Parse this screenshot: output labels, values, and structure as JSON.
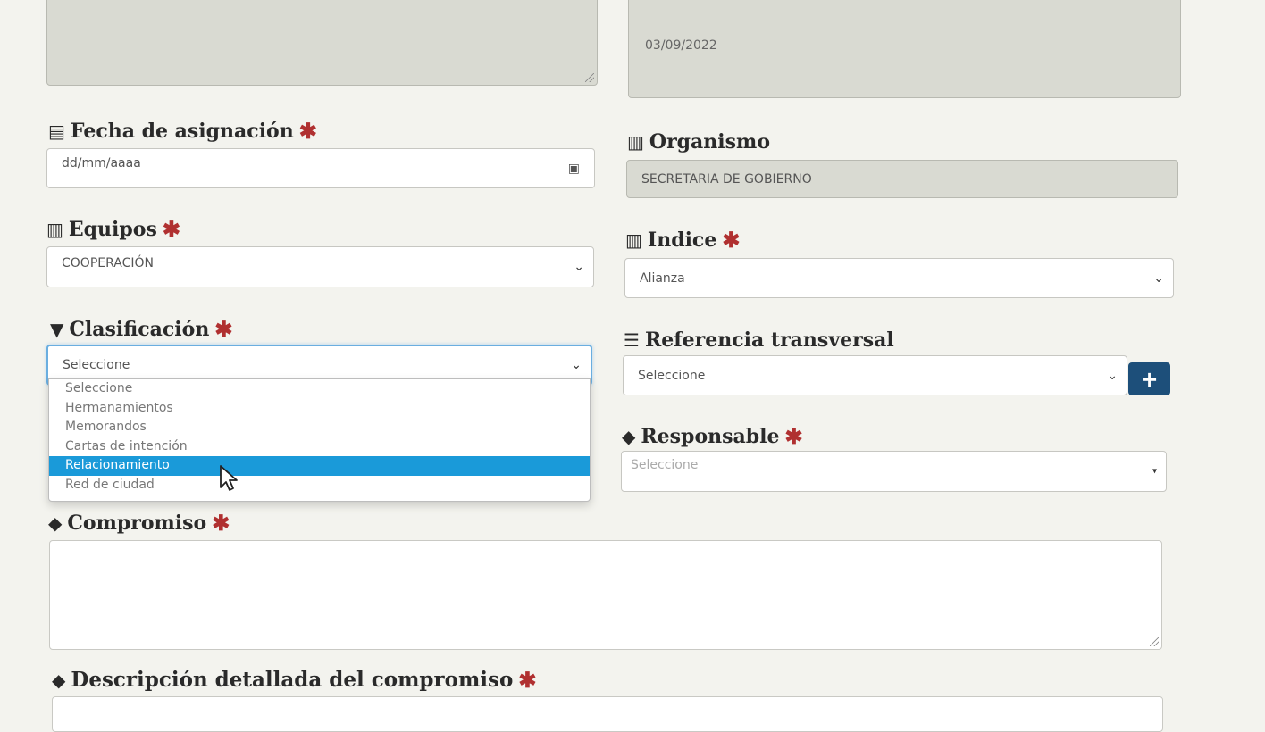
{
  "top": {
    "left_textarea_value": "",
    "right_date_value": "03/09/2022"
  },
  "fields": {
    "fecha_asignacion": {
      "label": "Fecha de asignación",
      "placeholder": "dd/mm/aaaa",
      "icon": "calendar-icon"
    },
    "organismo": {
      "label": "Organismo",
      "value": "SECRETARIA DE GOBIERNO",
      "icon": "barcode-icon"
    },
    "equipos": {
      "label": "Equipos",
      "value": "COOPERACIÓN",
      "icon": "barcode-icon"
    },
    "indice": {
      "label": "Indice",
      "value": "Alianza",
      "icon": "barcode-icon"
    },
    "clasificacion": {
      "label": "Clasificación",
      "value": "Seleccione",
      "icon": "filter-icon",
      "options": [
        "Seleccione",
        "Hermanamientos",
        "Memorandos",
        "Cartas de intención",
        "Relacionamiento",
        "Red de ciudad"
      ],
      "highlighted": "Relacionamiento"
    },
    "referencia_transversal": {
      "label": "Referencia transversal",
      "value": "Seleccione",
      "icon": "list-icon",
      "add_label": "+"
    },
    "responsable": {
      "label": "Responsable",
      "value": "Seleccione",
      "icon": "tag-icon"
    },
    "compromiso": {
      "label": "Compromiso",
      "icon": "tag-icon"
    },
    "descripcion": {
      "label": "Descripción detallada del compromiso",
      "icon": "tag-icon"
    }
  },
  "required_mark": "✱",
  "colors": {
    "required": "#b03030",
    "highlight": "#1a9ad9",
    "add_button": "#1d4f7a"
  }
}
